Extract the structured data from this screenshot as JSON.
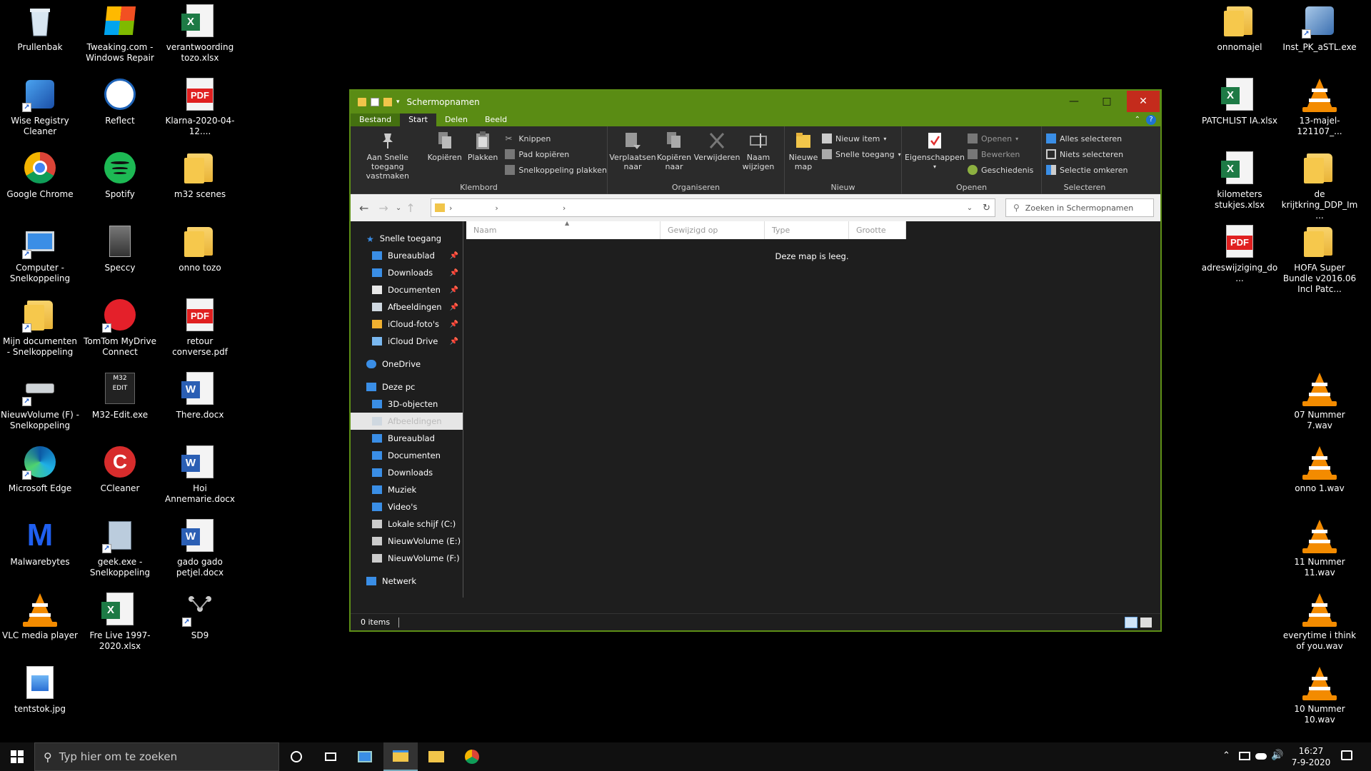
{
  "desktop": {
    "left_icons": [
      {
        "label": "Prullenbak",
        "icon": "recycle-bin-icon"
      },
      {
        "label": "Tweaking.com - Windows Repair",
        "icon": "windows-repair-icon"
      },
      {
        "label": "verantwoording tozo.xlsx",
        "icon": "excel-file-icon"
      },
      {
        "label": "Wise Registry Cleaner",
        "icon": "registry-cleaner-icon"
      },
      {
        "label": "Reflect",
        "icon": "reflect-icon"
      },
      {
        "label": "Klarna-2020-04-12....",
        "icon": "pdf-file-icon"
      },
      {
        "label": "Google Chrome",
        "icon": "chrome-icon"
      },
      {
        "label": "Spotify",
        "icon": "spotify-icon"
      },
      {
        "label": "m32 scenes",
        "icon": "folder-icon"
      },
      {
        "label": "Computer - Snelkoppeling",
        "icon": "computer-icon"
      },
      {
        "label": "Speccy",
        "icon": "speccy-icon"
      },
      {
        "label": "onno tozo",
        "icon": "folder-icon"
      },
      {
        "label": "Mijn documenten - Snelkoppeling",
        "icon": "documents-folder-icon"
      },
      {
        "label": "TomTom MyDrive Connect",
        "icon": "tomtom-icon"
      },
      {
        "label": "retour converse.pdf",
        "icon": "pdf-file-icon"
      },
      {
        "label": "NieuwVolume (F) - Snelkoppeling",
        "icon": "drive-icon"
      },
      {
        "label": "M32-Edit.exe",
        "icon": "m32-edit-icon"
      },
      {
        "label": "There.docx",
        "icon": "word-file-icon"
      },
      {
        "label": "Microsoft Edge",
        "icon": "edge-icon"
      },
      {
        "label": "CCleaner",
        "icon": "ccleaner-icon"
      },
      {
        "label": "Hoi Annemarie.docx",
        "icon": "word-file-icon"
      },
      {
        "label": "Malwarebytes",
        "icon": "malwarebytes-icon"
      },
      {
        "label": "geek.exe - Snelkoppeling",
        "icon": "geek-icon"
      },
      {
        "label": "gado gado petjel.docx",
        "icon": "word-file-icon"
      },
      {
        "label": "VLC media player",
        "icon": "vlc-icon"
      },
      {
        "label": "Fre Live 1997-2020.xlsx",
        "icon": "excel-file-icon"
      },
      {
        "label": "SD9",
        "icon": "sd9-icon"
      },
      {
        "label": "tentstok.jpg",
        "icon": "image-file-icon"
      }
    ],
    "right_icons": [
      {
        "label": "onnomajel",
        "icon": "folder-icon"
      },
      {
        "label": "Inst_PK_aSTL.exe",
        "icon": "installer-icon"
      },
      {
        "label": "PATCHLIST IA.xlsx",
        "icon": "excel-file-icon"
      },
      {
        "label": "13-majel-121107_...",
        "icon": "vlc-file-icon"
      },
      {
        "label": "kilometers stukjes.xlsx",
        "icon": "excel-file-icon"
      },
      {
        "label": "de krijtkring_DDP_Im...",
        "icon": "folder-icon"
      },
      {
        "label": "adreswijziging_do...",
        "icon": "pdf-file-icon"
      },
      {
        "label": "HOFA Super Bundle v2016.06 Incl Patc...",
        "icon": "folder-icon"
      },
      {
        "label": "07 Nummer 7.wav",
        "icon": "vlc-file-icon"
      },
      {
        "label": "onno 1.wav",
        "icon": "vlc-file-icon"
      },
      {
        "label": "11 Nummer 11.wav",
        "icon": "vlc-file-icon"
      },
      {
        "label": "everytime i think of you.wav",
        "icon": "vlc-file-icon"
      },
      {
        "label": "10 Nummer 10.wav",
        "icon": "vlc-file-icon"
      }
    ]
  },
  "explorer": {
    "title": "Schermopnamen",
    "tabs": [
      "Bestand",
      "Start",
      "Delen",
      "Beeld"
    ],
    "ribbon": {
      "klembord": {
        "label": "Klembord",
        "pin": "Aan Snelle toegang vastmaken",
        "copy": "Kopiëren",
        "paste": "Plakken",
        "cut": "Knippen",
        "copy_path": "Pad kopiëren",
        "paste_shortcut": "Snelkoppeling plakken"
      },
      "organiseren": {
        "label": "Organiseren",
        "move": "Verplaatsen naar",
        "copy_to": "Kopiëren naar",
        "delete": "Verwijderen",
        "rename": "Naam wijzigen"
      },
      "nieuw": {
        "label": "Nieuw",
        "new_folder": "Nieuwe map",
        "new_item": "Nieuw item",
        "easy_access": "Snelle toegang"
      },
      "openen": {
        "label": "Openen",
        "properties": "Eigenschappen",
        "open": "Openen",
        "edit": "Bewerken",
        "history": "Geschiedenis"
      },
      "selecteren": {
        "label": "Selecteren",
        "select_all": "Alles selecteren",
        "select_none": "Niets selecteren",
        "invert": "Selectie omkeren"
      }
    },
    "search_placeholder": "Zoeken in Schermopnamen",
    "nav": {
      "quick_access": "Snelle toegang",
      "quick_items": [
        "Bureaublad",
        "Downloads",
        "Documenten",
        "Afbeeldingen",
        "iCloud-foto's",
        "iCloud Drive"
      ],
      "onedrive": "OneDrive",
      "this_pc": "Deze pc",
      "pc_items": [
        "3D-objecten",
        "Afbeeldingen",
        "Bureaublad",
        "Documenten",
        "Downloads",
        "Muziek",
        "Video's",
        "Lokale schijf (C:)",
        "NieuwVolume (E:)",
        "NieuwVolume (F:)"
      ],
      "network": "Netwerk"
    },
    "columns": [
      "Naam",
      "Gewijzigd op",
      "Type",
      "Grootte"
    ],
    "empty_message": "Deze map is leeg.",
    "status": "0 items"
  },
  "taskbar": {
    "search_placeholder": "Typ hier om te zoeken",
    "time": "16:27",
    "date": "7-9-2020"
  },
  "colors": {
    "accent": "#5a8c14",
    "close": "#c42b1c"
  }
}
